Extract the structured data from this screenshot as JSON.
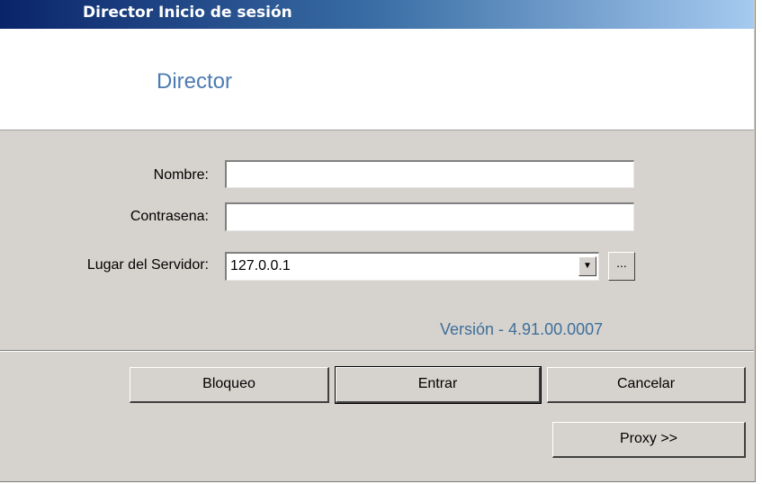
{
  "window": {
    "title": "Director Inicio de sesión"
  },
  "banner": {
    "app_name": "Director"
  },
  "form": {
    "name_label": "Nombre:",
    "name_value": "",
    "password_label": "Contrasena:",
    "password_value": "",
    "server_label": "Lugar del Servidor:",
    "server_value": "127.0.0.1",
    "browse_label": "..."
  },
  "version": "Versión - 4.91.00.0007",
  "buttons": {
    "lock": "Bloqueo",
    "enter": "Entrar",
    "cancel": "Cancelar",
    "proxy": "Proxy >>"
  }
}
